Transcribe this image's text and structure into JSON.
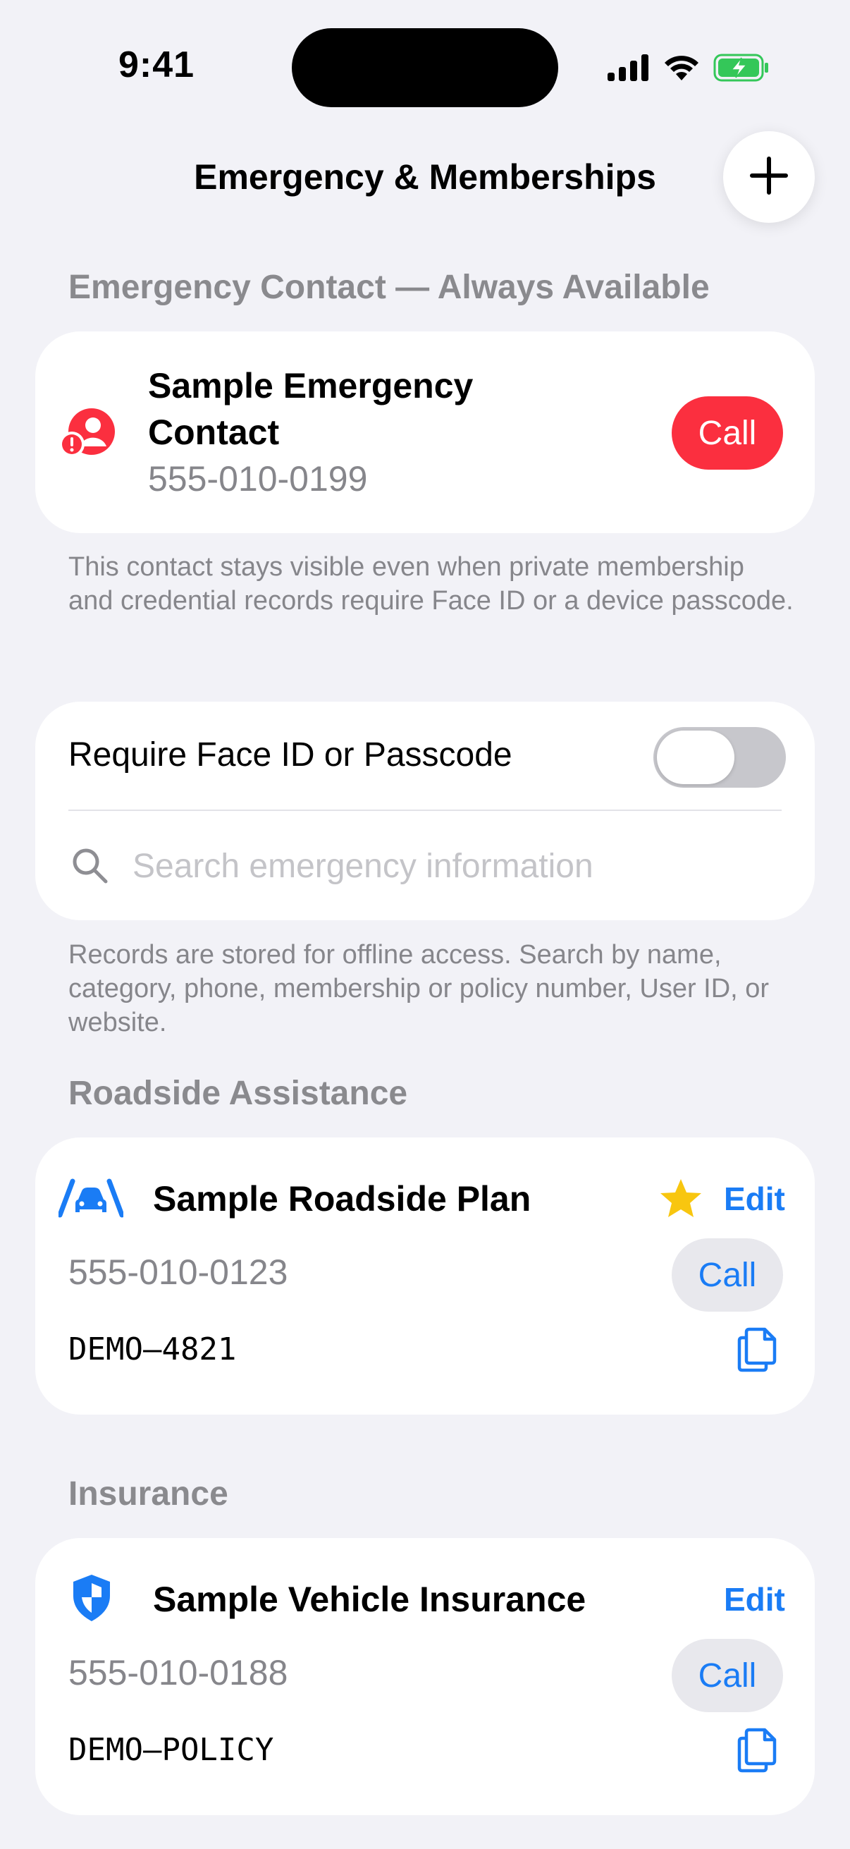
{
  "status_bar": {
    "time": "9:41"
  },
  "nav": {
    "title": "Emergency & Memberships"
  },
  "emergency_section": {
    "header": "Emergency Contact — Always Available",
    "contact_name_line1": "Sample Emergency",
    "contact_name_line2": "Contact",
    "contact_phone": "555-010-0199",
    "call_label": "Call",
    "footnote": "This contact stays visible even when private membership and credential records require Face ID or a device passcode."
  },
  "security": {
    "toggle_label": "Require Face ID or Passcode",
    "toggle_on": false,
    "search_placeholder": "Search emergency information",
    "footnote": "Records are stored for offline access. Search by name, category, phone, membership or policy number, User ID, or website."
  },
  "roadside": {
    "header": "Roadside Assistance",
    "title": "Sample Roadside Plan",
    "favorite": true,
    "edit_label": "Edit",
    "phone": "555-010-0123",
    "call_label": "Call",
    "code": "DEMO–4821"
  },
  "insurance": {
    "header": "Insurance",
    "title": "Sample Vehicle Insurance",
    "edit_label": "Edit",
    "phone": "555-010-0188",
    "call_label": "Call",
    "code": "DEMO–POLICY"
  },
  "colors": {
    "accent": "#1a7cf5",
    "danger": "#fb2f3f",
    "star": "#f8c60f",
    "battery": "#34c759"
  },
  "icons": [
    "signal-icon",
    "wifi-icon",
    "battery-charging-icon",
    "plus-icon",
    "emergency-contact-icon",
    "search-icon",
    "car-icon",
    "star-icon",
    "copy-icon",
    "shield-icon"
  ]
}
